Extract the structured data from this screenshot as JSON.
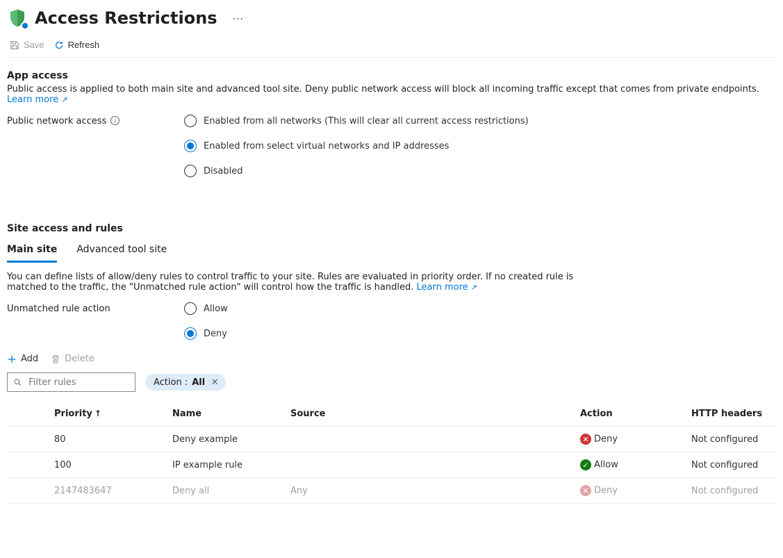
{
  "header": {
    "title": "Access Restrictions"
  },
  "toolbar": {
    "save": "Save",
    "refresh": "Refresh"
  },
  "app_access": {
    "heading": "App access",
    "desc": "Public access is applied to both main site and advanced tool site. Deny public network access will block all incoming traffic except that comes from private endpoints.",
    "learn_more": "Learn more",
    "field_label": "Public network access",
    "options": {
      "all": "Enabled from all networks (This will clear all current access restrictions)",
      "select": "Enabled from select virtual networks and IP addresses",
      "disabled": "Disabled"
    }
  },
  "site_access": {
    "heading": "Site access and rules",
    "tabs": {
      "main": "Main site",
      "tools": "Advanced tool site"
    },
    "desc": "You can define lists of allow/deny rules to control traffic to your site. Rules are evaluated in priority order. If no created rule is matched to the traffic, the \"Unmatched rule action\" will control how the traffic is handled.",
    "learn_more": "Learn more",
    "unmatched_label": "Unmatched rule action",
    "options": {
      "allow": "Allow",
      "deny": "Deny"
    }
  },
  "rules_toolbar": {
    "add": "Add",
    "delete": "Delete"
  },
  "search": {
    "placeholder": "Filter rules"
  },
  "filter_pill": {
    "label": "Action :",
    "value": "All"
  },
  "table": {
    "headers": {
      "priority": "Priority",
      "name": "Name",
      "source": "Source",
      "action": "Action",
      "http": "HTTP headers"
    },
    "rows": [
      {
        "priority": "80",
        "name": "Deny example",
        "source": "",
        "action": "Deny",
        "action_type": "deny",
        "http": "Not configured",
        "grey": false
      },
      {
        "priority": "100",
        "name": "IP example rule",
        "source": "",
        "action": "Allow",
        "action_type": "allow",
        "http": "Not configured",
        "grey": false
      },
      {
        "priority": "2147483647",
        "name": "Deny all",
        "source": "Any",
        "action": "Deny",
        "action_type": "deny",
        "http": "Not configured",
        "grey": true
      }
    ]
  }
}
